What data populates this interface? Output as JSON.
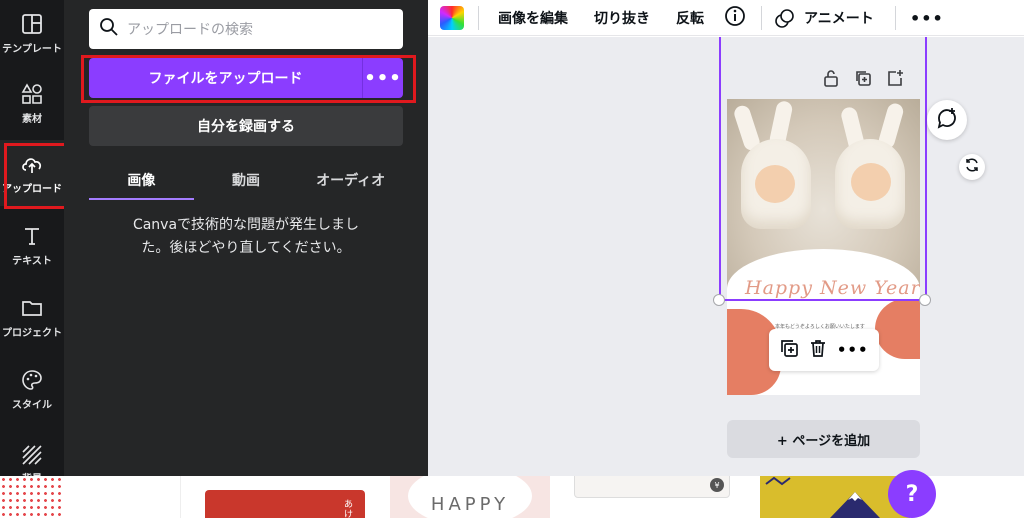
{
  "sidebar": {
    "items": [
      {
        "label": "テンプレート",
        "icon": "template-icon"
      },
      {
        "label": "素材",
        "icon": "elements-icon"
      },
      {
        "label": "アップロード",
        "icon": "upload-cloud-icon"
      },
      {
        "label": "テキスト",
        "icon": "text-icon"
      },
      {
        "label": "プロジェクト",
        "icon": "folder-icon"
      },
      {
        "label": "スタイル",
        "icon": "palette-icon"
      },
      {
        "label": "背景",
        "icon": "background-icon"
      }
    ],
    "active_index": 2
  },
  "panel": {
    "search_placeholder": "アップロードの検索",
    "upload_button": "ファイルをアップロード",
    "more_label": "•••",
    "record_button": "自分を録画する",
    "tabs": [
      {
        "label": "画像"
      },
      {
        "label": "動画"
      },
      {
        "label": "オーディオ"
      }
    ],
    "active_tab": 0,
    "error_message": "Canvaで技術的な問題が発生しました。後ほどやり直してください。"
  },
  "toolbar": {
    "edit_image": "画像を編集",
    "crop": "切り抜き",
    "flip": "反転",
    "animate": "アニメート",
    "more": "•••"
  },
  "canvas": {
    "design_title": "Happy New Year",
    "greeting": "本年もどうぞよろしくお願いいたします",
    "add_page": "+ ページを追加",
    "float_more": "•••"
  },
  "bottom": {
    "happy_text": "HAPPY",
    "red_card_text": "あけ",
    "yen_text": "¥",
    "help": "?"
  },
  "colors": {
    "accent": "#8b3dff",
    "highlight": "#e0191e",
    "panel_bg": "#252627",
    "rail_bg": "#18191b",
    "canvas_bg": "#ebecf0"
  }
}
